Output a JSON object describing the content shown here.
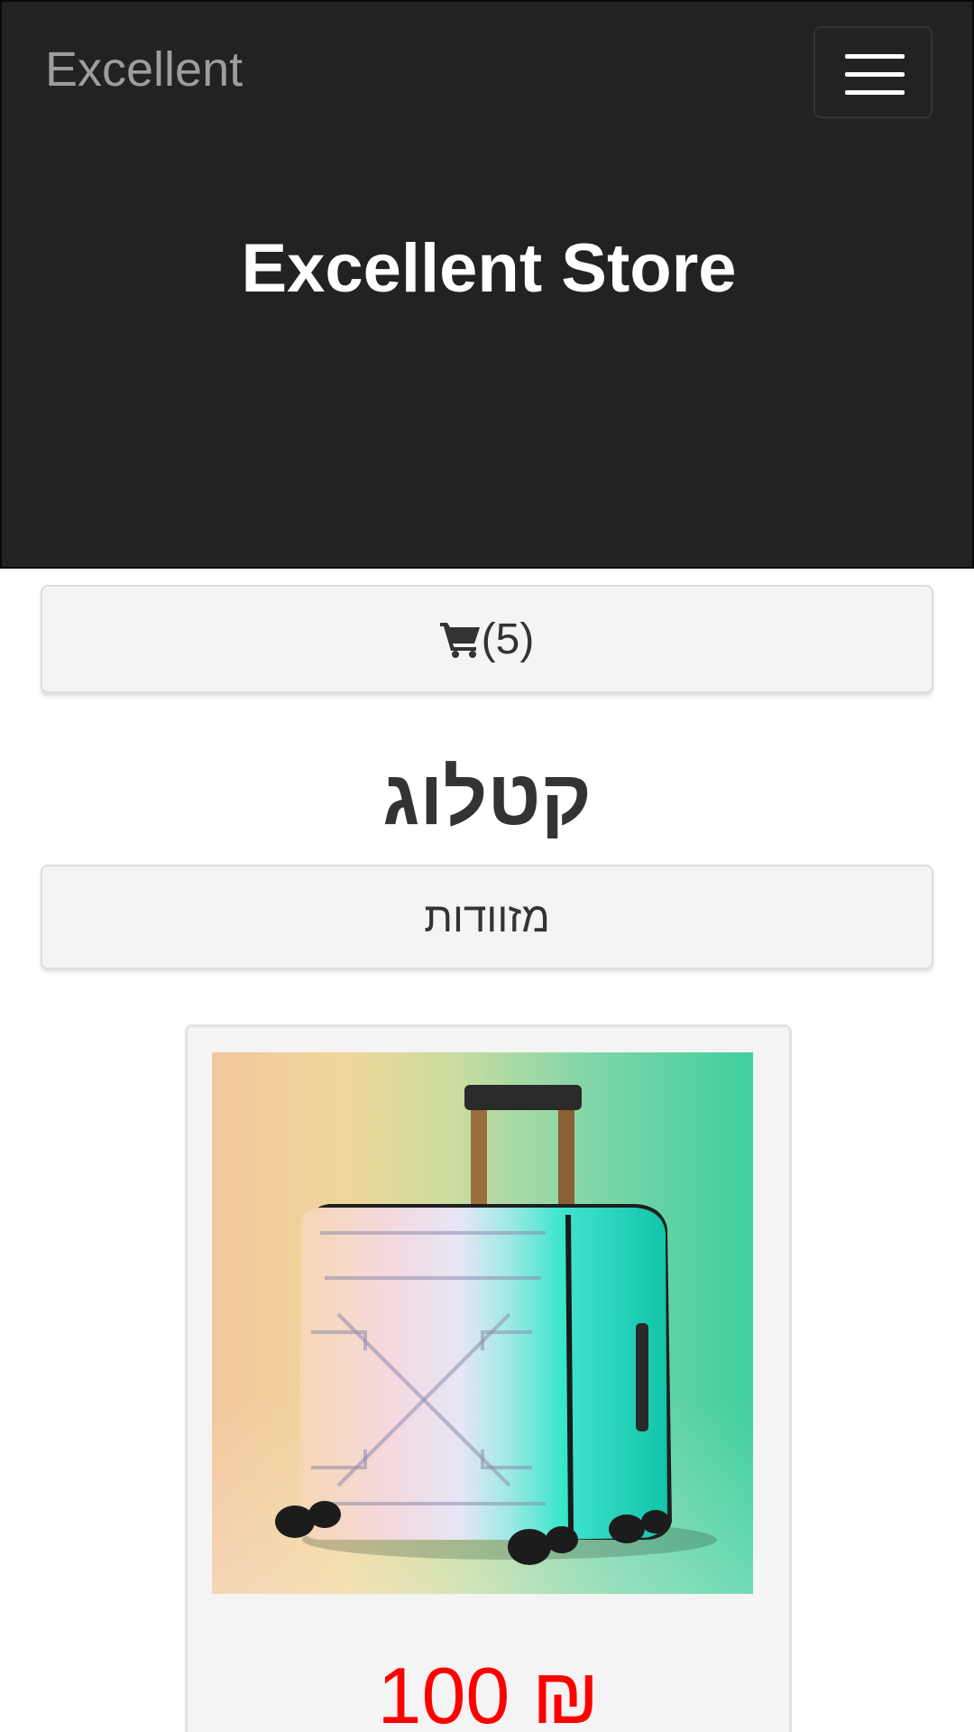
{
  "navbar": {
    "brand": "Excellent",
    "menu_toggle": "hamburger-menu"
  },
  "hero": {
    "title": "Excellent Store"
  },
  "cart": {
    "label": "(5)",
    "icon": "shopping-cart-icon"
  },
  "catalog": {
    "heading": "קטלוג",
    "category_label": "מזוודות"
  },
  "product": {
    "image": "white-suitcase-photo",
    "price": "100 ₪"
  },
  "colors": {
    "header_bg": "#222222",
    "brand_text": "#9d9d9d",
    "button_bg": "#f4f4f4",
    "price": "#ff0000"
  }
}
